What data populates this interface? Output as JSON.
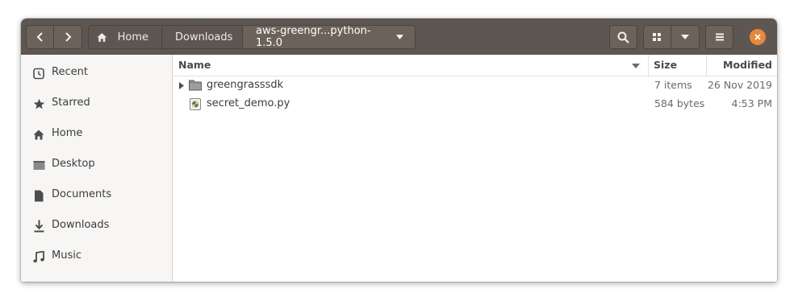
{
  "pathbar": {
    "home_label": "Home",
    "crumbs": [
      "Downloads",
      "aws-greengr...python-1.5.0"
    ]
  },
  "sidebar": {
    "items": [
      {
        "label": "Recent",
        "icon": "clock-icon"
      },
      {
        "label": "Starred",
        "icon": "star-icon"
      },
      {
        "label": "Home",
        "icon": "home-icon"
      },
      {
        "label": "Desktop",
        "icon": "desktop-icon"
      },
      {
        "label": "Documents",
        "icon": "document-icon"
      },
      {
        "label": "Downloads",
        "icon": "download-icon"
      },
      {
        "label": "Music",
        "icon": "music-icon"
      }
    ]
  },
  "columns": {
    "name": "Name",
    "size": "Size",
    "modified": "Modified"
  },
  "files": [
    {
      "name": "greengrasssdk",
      "type": "folder",
      "size": "7 items",
      "modified": "26 Nov 2019"
    },
    {
      "name": "secret_demo.py",
      "type": "python-file",
      "size": "584 bytes",
      "modified": "4:53 PM"
    }
  ],
  "colors": {
    "headerbar": "#5e5650",
    "close_button": "#e8883a",
    "sidebar_bg": "#f7f6f5"
  }
}
